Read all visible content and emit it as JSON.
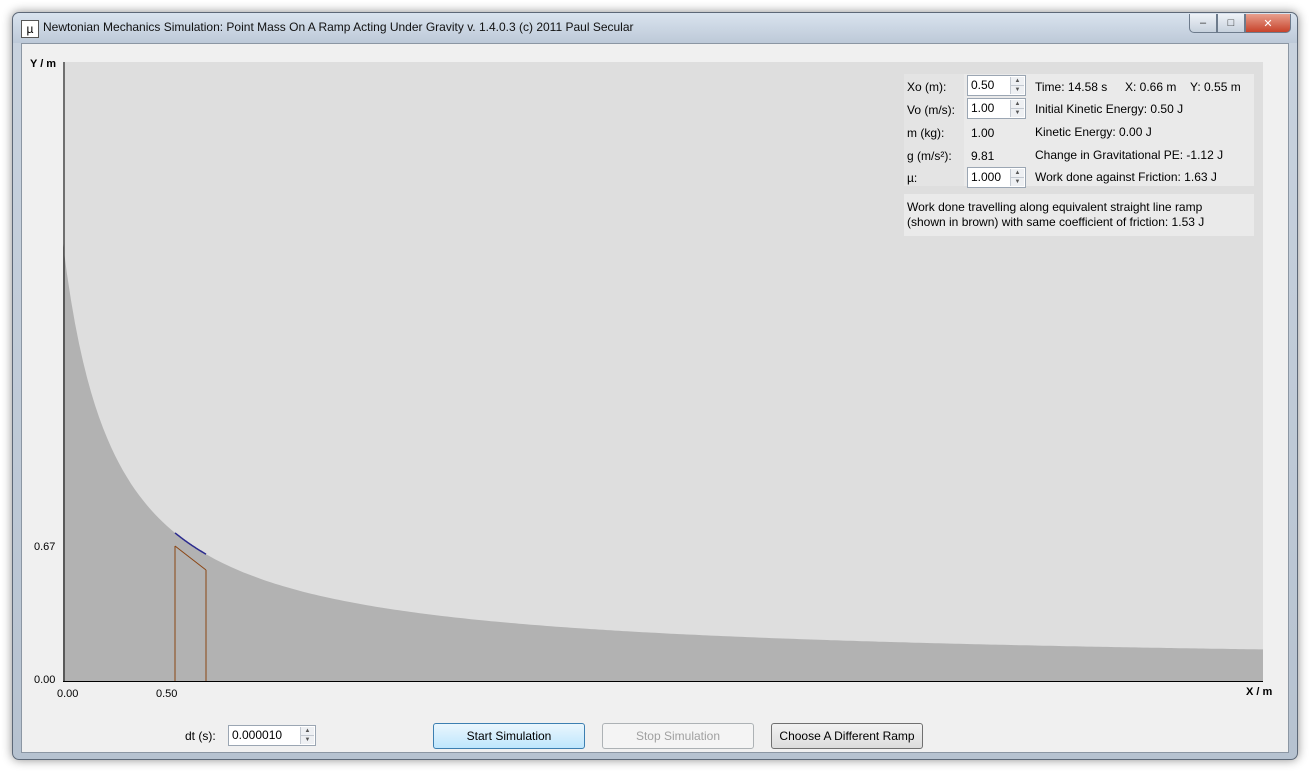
{
  "window": {
    "title": "Newtonian Mechanics Simulation: Point Mass On A Ramp Acting Under Gravity v. 1.4.0.3 (c) 2011 Paul Secular",
    "icon_glyph": "µ",
    "controls": {
      "minimize": "–",
      "maximize": "□",
      "close": "✕"
    }
  },
  "plot": {
    "y_axis_title": "Y / m",
    "x_axis_title": "X / m",
    "y_ticks": [
      "0.67",
      "0.00"
    ],
    "x_ticks": [
      "0.00",
      "0.50"
    ],
    "colors": {
      "background": "#dedede",
      "ramp_fill": "#b2b2b2",
      "straight_ramp": "#8b4513",
      "path": "#2b2b8f"
    }
  },
  "params": {
    "xo": {
      "label": "Xo (m):",
      "value": "0.50"
    },
    "vo": {
      "label": "Vo (m/s):",
      "value": "1.00"
    },
    "m": {
      "label": "m (kg):",
      "value": "1.00"
    },
    "g": {
      "label": "g (m/s²):",
      "value": "9.81"
    },
    "mu": {
      "label": "µ:",
      "value": "1.000"
    }
  },
  "readouts": {
    "time": "Time: 14.58 s",
    "x": "X: 0.66 m",
    "y": "Y: 0.55 m",
    "initial_ke": "Initial Kinetic Energy: 0.50 J",
    "ke": "Kinetic Energy: 0.00 J",
    "gpe": "Change in Gravitational PE: -1.12 J",
    "friction": "Work done against Friction: 1.63 J",
    "straight_line_1": "Work done travelling along equivalent straight line ramp",
    "straight_line_2": "(shown in brown) with same coefficient of friction: 1.53 J"
  },
  "footer": {
    "dt_label": "dt (s):",
    "dt_value": "0.000010",
    "start_button": "Start Simulation",
    "stop_button": "Stop Simulation",
    "ramp_button": "Choose A Different Ramp"
  }
}
